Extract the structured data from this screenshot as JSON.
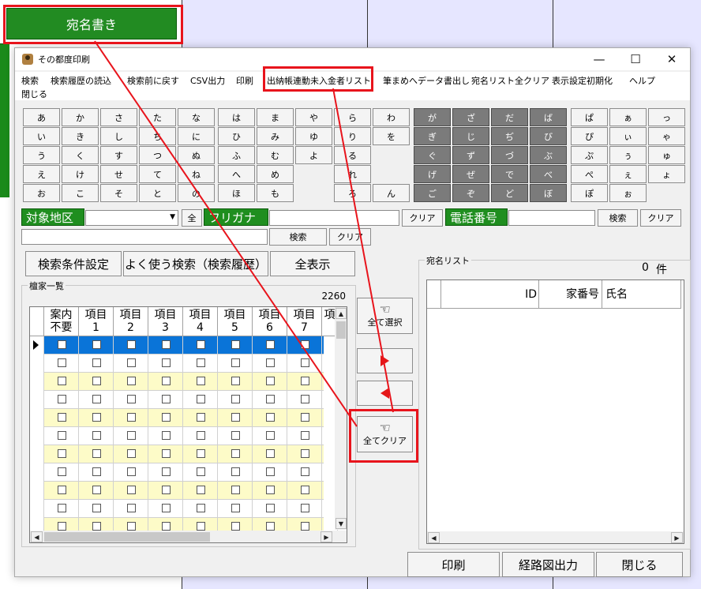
{
  "background": {
    "top_button": "宛名書き"
  },
  "window": {
    "title": "その都度印刷",
    "controls": {
      "minimize": "—",
      "maximize": "☐",
      "close": "✕"
    }
  },
  "menu": {
    "items": [
      "検索",
      "検索履歴の読込",
      "検索前に戻す",
      "CSV出力",
      "印刷",
      "出納帳連動未入金者リスト",
      "筆まめへデータ書出し",
      "宛名リスト全クリア",
      "表示設定初期化",
      "ヘルプ"
    ],
    "items2": [
      "閉じる"
    ]
  },
  "kana": {
    "block1": [
      [
        "あ",
        "か",
        "さ",
        "た",
        "な"
      ],
      [
        "い",
        "き",
        "し",
        "ち",
        "に"
      ],
      [
        "う",
        "く",
        "す",
        "つ",
        "ぬ"
      ],
      [
        "え",
        "け",
        "せ",
        "て",
        "ね"
      ],
      [
        "お",
        "こ",
        "そ",
        "と",
        "の"
      ]
    ],
    "block2": [
      [
        "は",
        "ま",
        "や",
        "ら",
        "わ"
      ],
      [
        "ひ",
        "み",
        "ゆ",
        "り",
        "を"
      ],
      [
        "ふ",
        "む",
        "よ",
        "る",
        ""
      ],
      [
        "へ",
        "め",
        "",
        "れ",
        ""
      ],
      [
        "ほ",
        "も",
        "",
        "ろ",
        "ん"
      ]
    ],
    "block3": [
      [
        "が",
        "ざ",
        "だ",
        "ば"
      ],
      [
        "ぎ",
        "じ",
        "ぢ",
        "び"
      ],
      [
        "ぐ",
        "ず",
        "づ",
        "ぶ"
      ],
      [
        "げ",
        "ぜ",
        "で",
        "べ"
      ],
      [
        "ご",
        "ぞ",
        "ど",
        "ぼ"
      ]
    ],
    "block4": [
      [
        "ぱ",
        "ぁ",
        "っ"
      ],
      [
        "ぴ",
        "ぃ",
        "ゃ"
      ],
      [
        "ぷ",
        "ぅ",
        "ゅ"
      ],
      [
        "ぺ",
        "ぇ",
        "ょ"
      ],
      [
        "ぽ",
        "ぉ",
        ""
      ]
    ]
  },
  "filters": {
    "area_label": "対象地区",
    "all_button": "全",
    "furigana_label": "フリガナ",
    "clear_button": "クリア",
    "phone_label": "電話番号",
    "search_button": "検索",
    "clear_button2": "クリア",
    "search_button2": "検索",
    "clear_button3": "クリア"
  },
  "actions": {
    "search_settings": "検索条件設定",
    "search_history": "よく使う検索（検索履歴）",
    "show_all": "全表示"
  },
  "danka": {
    "group_label": "檀家一覧",
    "count": "2260",
    "columns": [
      [
        "案内",
        "不要"
      ],
      [
        "項目",
        "1"
      ],
      [
        "項目",
        "2"
      ],
      [
        "項目",
        "3"
      ],
      [
        "項目",
        "4"
      ],
      [
        "項目",
        "5"
      ],
      [
        "項目",
        "6"
      ],
      [
        "項目",
        "7"
      ],
      [
        "項",
        ""
      ]
    ],
    "row_count": 11
  },
  "middle": {
    "select_all": "全て選択",
    "clear_all": "全てクリア",
    "hand_icon": "☜"
  },
  "address_list": {
    "group_label": "宛名リスト",
    "count": "0",
    "count_unit": "件",
    "columns": [
      "ID",
      "家番号",
      "氏名"
    ]
  },
  "bottom": {
    "print": "印刷",
    "route_map": "経路図出力",
    "close": "閉じる"
  },
  "colors": {
    "green": "#1f8e1f",
    "selected_row": "#0a74d8",
    "stripe": "#fdfbc8",
    "highlight_red": "#e8141c"
  }
}
